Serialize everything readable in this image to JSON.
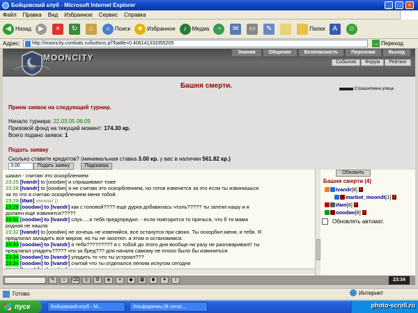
{
  "window": {
    "title": "Бойцовский клуб - Microsoft Internet Explorer",
    "min": "_",
    "max": "□",
    "close": "×"
  },
  "menu": [
    "Файл",
    "Правка",
    "Вид",
    "Избранное",
    "Сервис",
    "Справка"
  ],
  "toolbar": {
    "back": "Назад",
    "search": "Поиск",
    "favorites": "Избранное",
    "media": "Медиа",
    "folders": "Папки"
  },
  "address": {
    "label": "Адрес:",
    "url": "http://mooncity.combats.ru/buttons.pl?battle=0.406141333355205",
    "go": "Переход"
  },
  "game": {
    "brand": "MOONCITY",
    "nav_top": [
      "Знания",
      "Общение",
      "Безопасность",
      "Персонаж",
      "Выход"
    ],
    "nav_sub": [
      "События",
      "Форум",
      "Рейтинг"
    ],
    "title": "Башня смерти.",
    "exit": "Страшилкина улица",
    "section1": "Прием заявок на следующий турнир.",
    "start_label": "Начало турнира:",
    "start_value": "22.03.05 06:09",
    "prize_label": "Призовой фонд на текущий момент:",
    "prize_value": "174.30 кр.",
    "total_label": "Всего подано заявок:",
    "total_value": "1",
    "section2": "Подать заявку",
    "question_a": "Сколько ставите кредитов? (минимальная ставка",
    "question_min": "3.00 кр.",
    "question_b": "у вас в наличии",
    "question_have": "561.82 кр.)",
    "stake_value": "3.00",
    "submit": "Подать заявку",
    "hint": "Подсказка"
  },
  "chat": [
    {
      "time": "",
      "hl": false,
      "nick": "",
      "text": "шакал - считаю это оскорблением"
    },
    {
      "time": "23:25",
      "hl": false,
      "nick": "[Ivandr]",
      "text": "to [оооdин] и спрашивают тоже"
    },
    {
      "time": "23:28",
      "hl": false,
      "nick": "[Ivandr]",
      "text": "to [оооdин] я не считаю это оскорблением, но готов извенится за это если ты извинишься"
    },
    {
      "time": "",
      "hl": false,
      "nick": "",
      "text": "за то что я считаю оскорблением меня тобой."
    },
    {
      "time": "23:29",
      "hl": false,
      "nick": "[Имп]",
      "text": "умники ))"
    },
    {
      "time": "23:29",
      "hl": true,
      "nick": "[оооdин] to [Ivandr]",
      "text": "как с головой???? еще дурка добавилась чтоль????? ты затеял кашу и я"
    },
    {
      "time": "",
      "hl": false,
      "nick": "",
      "text": "должен еще извинятся?????"
    },
    {
      "time": "23:31",
      "hl": true,
      "nick": "[оооdин] to [Ivandr]",
      "text": "слух.....я тебя предупредил. - если повторится то прячься, что б тя мама"
    },
    {
      "time": "",
      "hl": false,
      "nick": "",
      "text": "родная не нашла"
    },
    {
      "time": "23:32",
      "hl": false,
      "nick": "[Ivandr]",
      "text": "to [оооdин] не хочешь не извеняйся, все останутся при своих. Ты оскорбил меня, я тебя. Я"
    },
    {
      "time": "",
      "hl": false,
      "nick": "",
      "text": "предлогал заладить все миром, но ты не захотел. а этом и остановимся."
    },
    {
      "time": "23:33",
      "hl": true,
      "nick": "[оооdин] to [Ivandr]",
      "text": "я тебя????????? я с тобой до этого дня вообще ни разу не разговаривал!! ты"
    },
    {
      "time": "",
      "hl": false,
      "nick": "",
      "text": "предлагал уладить????? что за бред??? для начала самому не плохо было бы извиниться"
    },
    {
      "time": "23:34",
      "hl": true,
      "nick": "[оооdин] to [Ivandr]",
      "text": "уладить то что ты устроил???"
    },
    {
      "time": "23:34",
      "hl": true,
      "nick": "[оооdин] to [Ivandr]",
      "text": "считай что ты отделался легким испугом сегодня"
    },
    {
      "time": "23:34",
      "hl": false,
      "nick": "[Ivandr]",
      "text": "to [оооdин] я закончил разговор"
    }
  ],
  "side": {
    "refresh": "Обновить",
    "title": "Башня смерти (4)",
    "players": [
      {
        "name": "Ivandr",
        "level": "[8]",
        "c1": "#ff7b00",
        "c2": "#1b6ee0"
      },
      {
        "name": "marbot_moondt",
        "level": "[1]",
        "c1": "#1b6ee0",
        "c2": "#8b0000"
      },
      {
        "name": "Имп",
        "level": "[8]",
        "c1": "#c00000",
        "c2": "#555555"
      },
      {
        "name": "оооdин",
        "level": "[8]",
        "c1": "#00a000",
        "c2": "#8b0000"
      }
    ],
    "auto": "Обновлять автомат."
  },
  "clock": "23:34",
  "status": {
    "done": "Готово",
    "zone": "Интернет"
  },
  "taskbar": {
    "start": "пуск",
    "tasks": [
      "Бойцовский клуб - M...",
      "Ильфаринец (В сети):..."
    ],
    "watermark": "photo-scroll.ru"
  }
}
